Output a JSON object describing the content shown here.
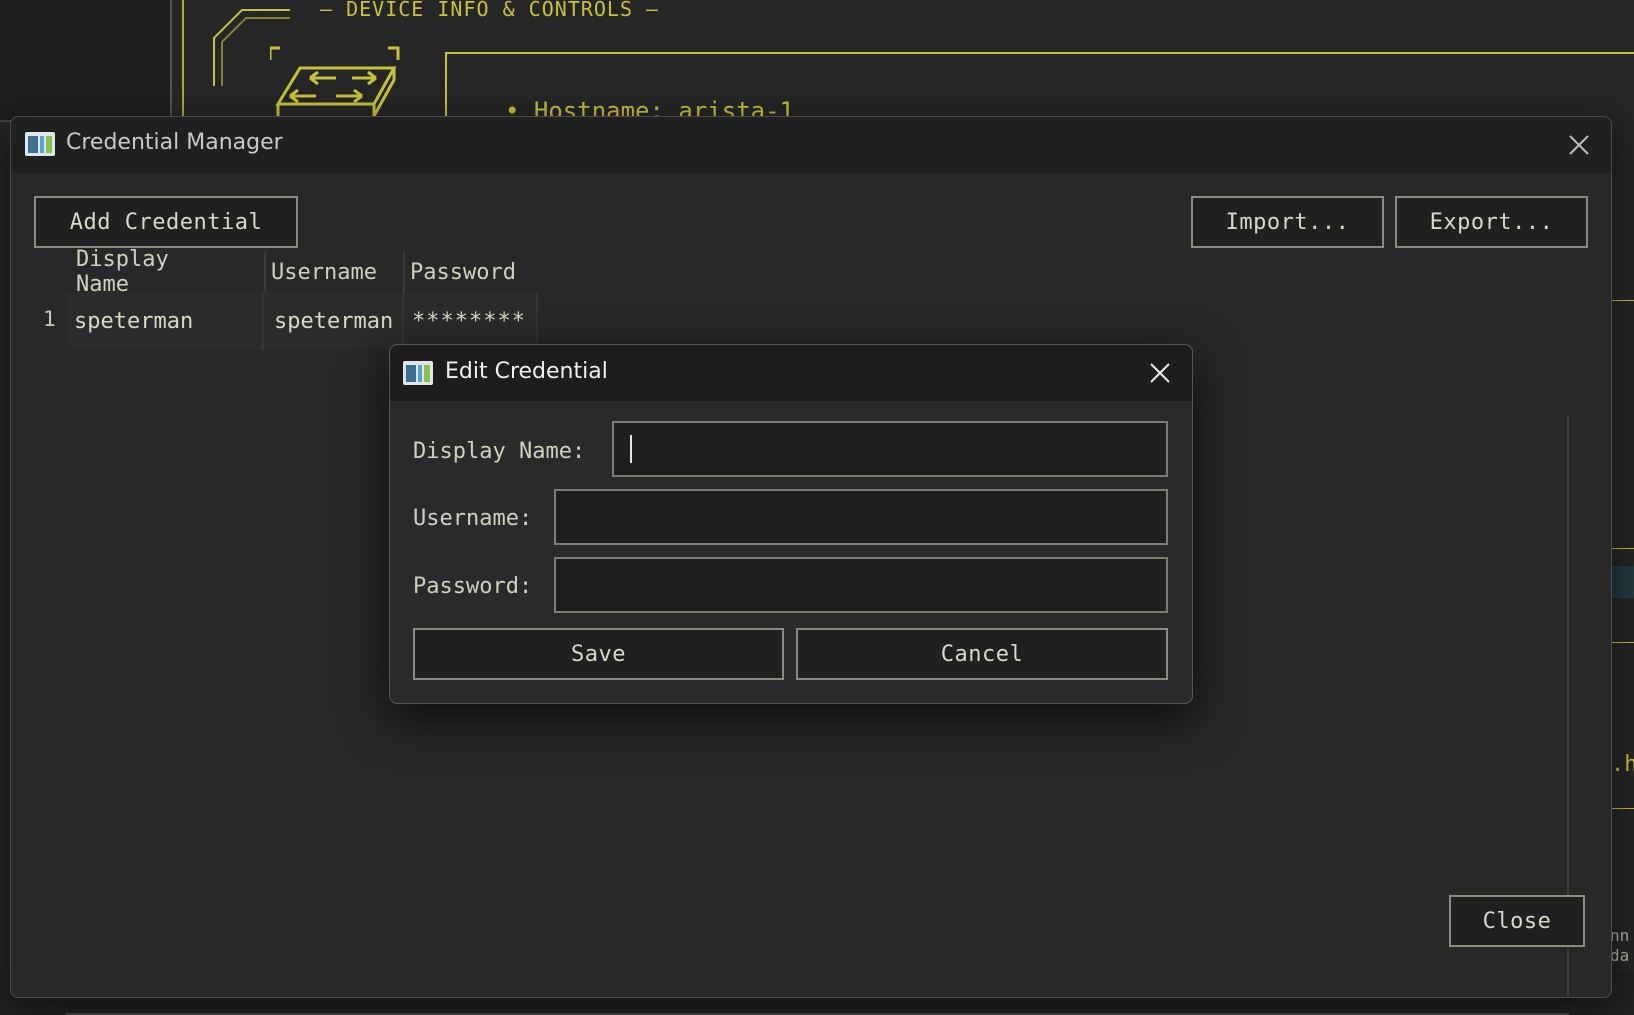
{
  "background": {
    "section_title": "— DEVICE INFO & CONTROLS —",
    "info_line": "• Hostname: arista-1",
    "right_edge_text_1": ".h",
    "right_edge_text_2": "nn",
    "right_edge_text_3": "da",
    "accent_color": "#c7c23a"
  },
  "credential_manager": {
    "title": "Credential Manager",
    "icon": "app-window-icon",
    "add_button": "Add Credential",
    "import_button": "Import...",
    "export_button": "Export...",
    "close_button": "Close",
    "table": {
      "columns": [
        "Display Name",
        "Username",
        "Password"
      ],
      "rows": [
        {
          "index": "1",
          "display_name": "speterman",
          "username": "speterman",
          "password": "********"
        }
      ]
    }
  },
  "edit_dialog": {
    "title": "Edit Credential",
    "icon": "app-window-icon",
    "fields": {
      "display_name_label": "Display Name:",
      "display_name_value": "",
      "username_label": "Username:",
      "username_value": "",
      "password_label": "Password:",
      "password_value": ""
    },
    "save_button": "Save",
    "cancel_button": "Cancel"
  }
}
